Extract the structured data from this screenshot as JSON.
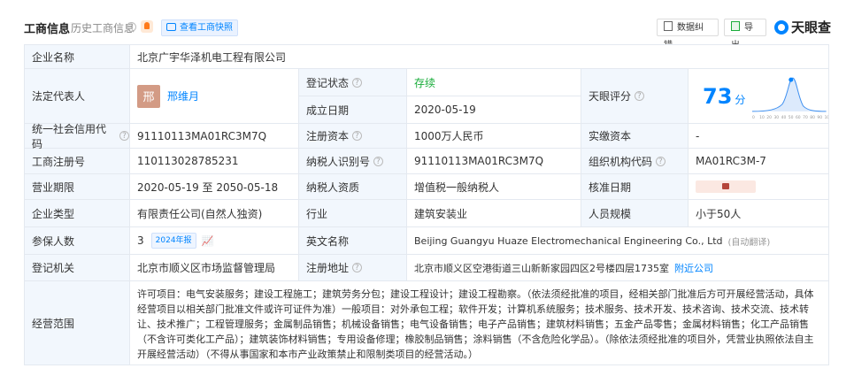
{
  "header": {
    "title": "工商信息",
    "history": "历史工商信息",
    "snapshot_button": "查看工商快照",
    "error_button": "数据纠错",
    "export_button": "导出",
    "brand": "天眼查"
  },
  "company_name_label": "企业名称",
  "company_name": "北京广宇华泽机电工程有限公司",
  "legal_rep_label": "法定代表人",
  "legal_rep_avatar": "邢",
  "legal_rep": "邢维月",
  "reg_status_label": "登记状态",
  "reg_status": "存续",
  "est_date_label": "成立日期",
  "est_date": "2020-05-19",
  "tianyan_score_label": "天眼评分",
  "tianyan_score": "73",
  "tianyan_score_unit": "分",
  "score_chart": {
    "type": "area",
    "x": [
      "0",
      "10",
      "20",
      "30",
      "40",
      "50",
      "60",
      "70",
      "80",
      "90",
      "100"
    ]
  },
  "credit_code_label": "统一社会信用代码",
  "credit_code": "91110113MA01RC3M7Q",
  "reg_capital_label": "注册资本",
  "reg_capital": "1000万人民币",
  "paid_capital_label": "实缴资本",
  "paid_capital": "-",
  "reg_number_label": "工商注册号",
  "reg_number": "110113028785231",
  "taxpayer_id_label": "纳税人识别号",
  "taxpayer_id": "91110113MA01RC3M7Q",
  "org_code_label": "组织机构代码",
  "org_code": "MA01RC3M-7",
  "term_label": "营业期限",
  "term": "2020-05-19 至 2050-05-18",
  "taxpayer_qual_label": "纳税人资质",
  "taxpayer_qual": "增值税一般纳税人",
  "approval_date_label": "核准日期",
  "company_type_label": "企业类型",
  "company_type": "有限责任公司(自然人独资)",
  "industry_label": "行业",
  "industry": "建筑安装业",
  "staff_size_label": "人员规模",
  "staff_size": "小于50人",
  "insured_label": "参保人数",
  "insured": "3",
  "insured_report": "2024年报",
  "english_name_label": "英文名称",
  "english_name": "Beijing Guangyu Huaze Electromechanical Engineering Co., Ltd",
  "english_name_note": "(自动翻译)",
  "reg_authority_label": "登记机关",
  "reg_authority": "北京市顺义区市场监督管理局",
  "reg_address_label": "注册地址",
  "reg_address": "北京市顺义区空港街道三山新新家园四区2号楼四层1735室",
  "nearby_link": "附近公司",
  "scope_label": "经营范围",
  "scope": "许可项目：电气安装服务；建设工程施工；建筑劳务分包；建设工程设计；建设工程勘察。（依法须经批准的项目，经相关部门批准后方可开展经营活动，具体经营项目以相关部门批准文件或许可证件为准）一般项目：对外承包工程；软件开发；计算机系统服务；技术服务、技术开发、技术咨询、技术交流、技术转让、技术推广；工程管理服务；金属制品销售；机械设备销售；电气设备销售；电子产品销售；建筑材料销售；五金产品零售；金属材料销售；化工产品销售（不含许可类化工产品）；建筑装饰材料销售；专用设备修理；橡胶制品销售；涂料销售（不含危险化学品）。（除依法须经批准的项目外，凭营业执照依法自主开展经营活动）（不得从事国家和本市产业政策禁止和限制类项目的经营活动。）",
  "colors": {
    "accent": "#0084ff",
    "status": "#1aad3b",
    "label_bg": "#f2f7fd"
  }
}
